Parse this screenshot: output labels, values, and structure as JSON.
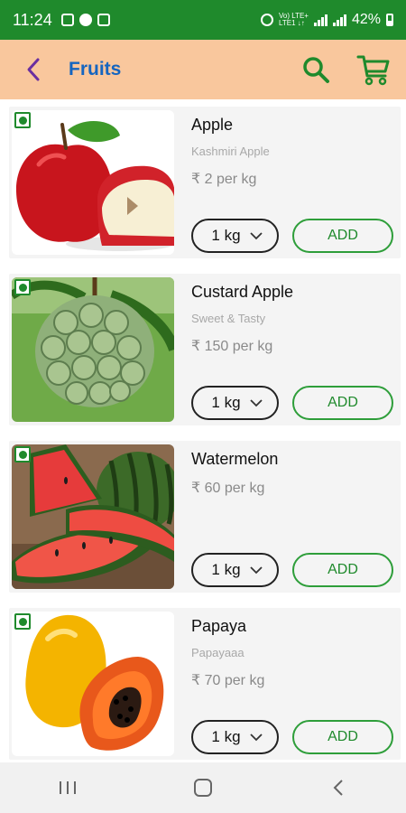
{
  "status": {
    "time": "11:24",
    "volte_top": "Vo) LTE+",
    "volte_bottom": "LTE1 ↓↑",
    "battery": "42%"
  },
  "header": {
    "title": "Fruits"
  },
  "colors": {
    "status_bar": "#1f8a2c",
    "header_bg": "#f9c79d",
    "title": "#1565c0",
    "accent_green": "#1f8a2c",
    "back_arrow": "#6a2fa0"
  },
  "products": [
    {
      "name": "Apple",
      "subtitle": "Kashmiri Apple",
      "price": "₹ 2 per kg",
      "qty": "1 kg",
      "add": "ADD",
      "image": "apple"
    },
    {
      "name": "Custard Apple",
      "subtitle": "Sweet & Tasty",
      "price": "₹ 150 per kg",
      "qty": "1 kg",
      "add": "ADD",
      "image": "custard-apple"
    },
    {
      "name": "Watermelon",
      "subtitle": "",
      "price": "₹ 60 per kg",
      "qty": "1 kg",
      "add": "ADD",
      "image": "watermelon"
    },
    {
      "name": "Papaya",
      "subtitle": "Papayaaa",
      "price": "₹ 70 per kg",
      "qty": "1 kg",
      "add": "ADD",
      "image": "papaya"
    }
  ]
}
